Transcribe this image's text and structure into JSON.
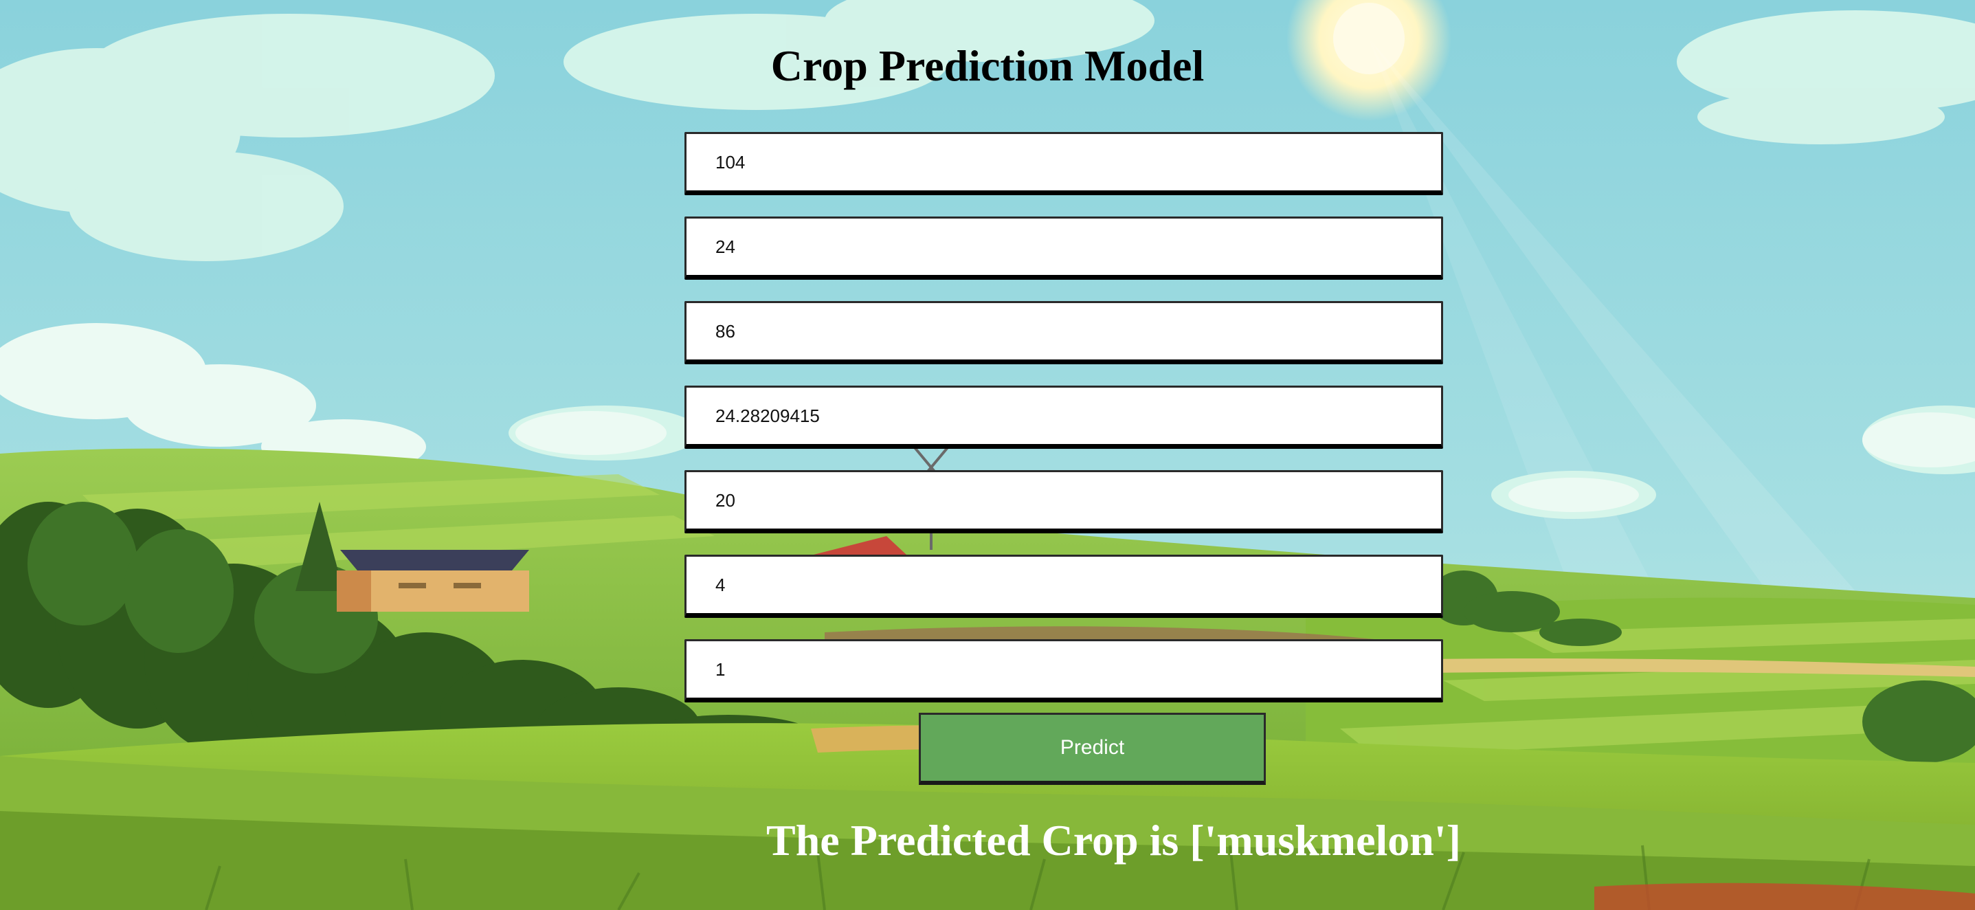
{
  "page": {
    "title": "Crop Prediction Model"
  },
  "form": {
    "fields": [
      {
        "value": "104"
      },
      {
        "value": "24"
      },
      {
        "value": "86"
      },
      {
        "value": "24.28209415"
      },
      {
        "value": "20"
      },
      {
        "value": "4"
      },
      {
        "value": "1"
      }
    ],
    "predict_label": "Predict"
  },
  "result": {
    "text": "The Predicted Crop is ['muskmelon']"
  },
  "colors": {
    "button": "#62a85a",
    "sky": "#8fd3df",
    "grass": "#7ab83a"
  }
}
